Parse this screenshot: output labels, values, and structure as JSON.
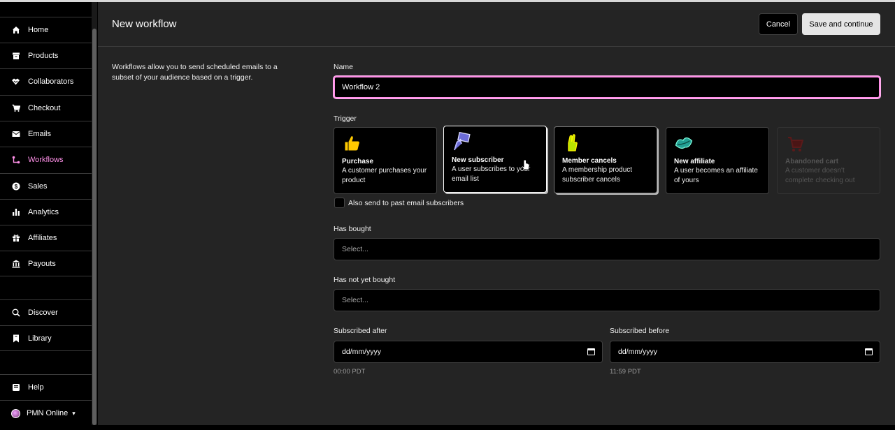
{
  "sidebar": {
    "items": [
      {
        "label": "Home",
        "icon": "home-icon"
      },
      {
        "label": "Products",
        "icon": "archive-icon"
      },
      {
        "label": "Collaborators",
        "icon": "handshake-icon"
      },
      {
        "label": "Checkout",
        "icon": "cart-icon"
      },
      {
        "label": "Emails",
        "icon": "envelope-icon"
      },
      {
        "label": "Workflows",
        "icon": "workflow-icon",
        "active": true
      },
      {
        "label": "Sales",
        "icon": "dollar-icon"
      },
      {
        "label": "Analytics",
        "icon": "bar-chart-icon"
      },
      {
        "label": "Affiliates",
        "icon": "gift-icon"
      },
      {
        "label": "Payouts",
        "icon": "bank-icon"
      }
    ],
    "secondary": [
      {
        "label": "Discover",
        "icon": "search-icon"
      },
      {
        "label": "Library",
        "icon": "bookmark-icon"
      }
    ],
    "help": {
      "label": "Help",
      "icon": "help-icon"
    },
    "account": {
      "label": "PMN Online",
      "icon": "avatar-icon"
    }
  },
  "header": {
    "title": "New workflow",
    "cancel_label": "Cancel",
    "save_label": "Save and continue"
  },
  "description": "Workflows allow you to send scheduled emails to a subset of your audience based on a trigger.",
  "form": {
    "name_label": "Name",
    "name_value": "Workflow 2",
    "trigger_label": "Trigger",
    "triggers": [
      {
        "title": "Purchase",
        "desc": "A customer purchases your product",
        "icon": "thumbs-up-icon",
        "state": "normal"
      },
      {
        "title": "New subscriber",
        "desc": "A user subscribes to your email list",
        "icon": "sign-icon",
        "state": "selected"
      },
      {
        "title": "Member cancels",
        "desc": "A membership product subscriber cancels",
        "icon": "crossed-fingers-icon",
        "state": "raised"
      },
      {
        "title": "New affiliate",
        "desc": "A user becomes an affiliate of yours",
        "icon": "lips-icon",
        "state": "normal"
      },
      {
        "title": "Abandoned cart",
        "desc": "A customer doesn't complete checking out",
        "icon": "cart-red-icon",
        "state": "disabled"
      }
    ],
    "past_subscribers_label": "Also send to past email subscribers",
    "has_bought_label": "Has bought",
    "has_bought_placeholder": "Select...",
    "has_not_bought_label": "Has not yet bought",
    "has_not_bought_placeholder": "Select...",
    "subscribed_after_label": "Subscribed after",
    "subscribed_after_value": "dd/mm/yyyy",
    "subscribed_after_hint": "00:00 PDT",
    "subscribed_before_label": "Subscribed before",
    "subscribed_before_value": "dd/mm/yyyy",
    "subscribed_before_hint": "11:59 PDT"
  },
  "colors": {
    "accent": "#ff90e8",
    "background": "#242424",
    "sidebar": "#000000"
  }
}
